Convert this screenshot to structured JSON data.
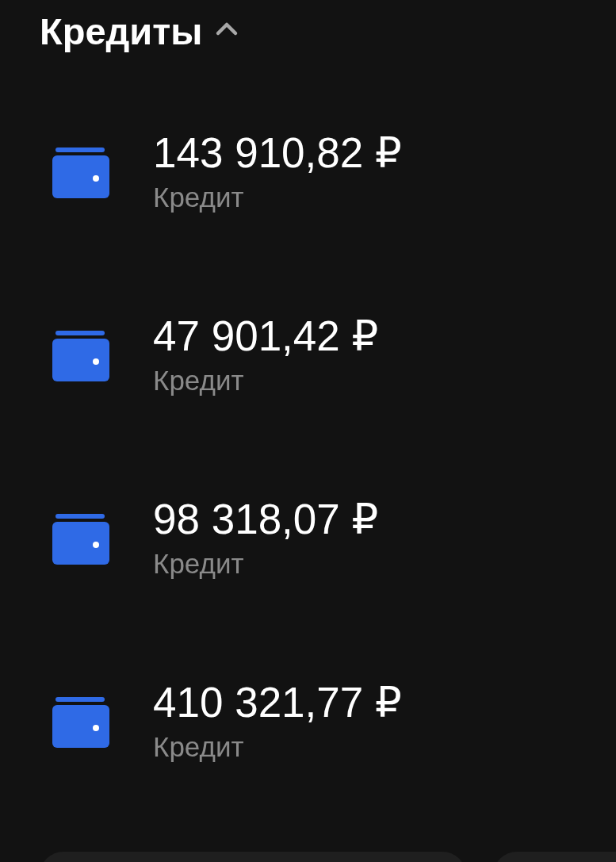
{
  "section": {
    "title": "Кредиты",
    "expanded": true
  },
  "accounts": [
    {
      "amount": "143 910,82 ₽",
      "label": "Кредит"
    },
    {
      "amount": "47 901,42 ₽",
      "label": "Кредит"
    },
    {
      "amount": "98 318,07 ₽",
      "label": "Кредит"
    },
    {
      "amount": "410 321,77 ₽",
      "label": "Кредит"
    }
  ]
}
